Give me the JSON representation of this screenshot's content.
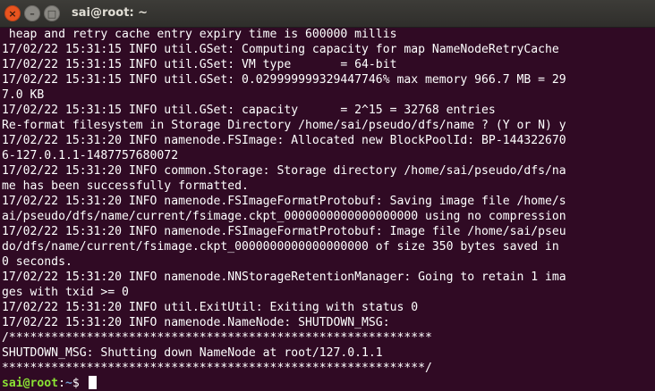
{
  "window": {
    "title": "sai@root: ~",
    "close_label": "×",
    "minimize_label": "–",
    "maximize_label": "□"
  },
  "terminal": {
    "lines": [
      " heap and retry cache entry expiry time is 600000 millis",
      "17/02/22 15:31:15 INFO util.GSet: Computing capacity for map NameNodeRetryCache",
      "17/02/22 15:31:15 INFO util.GSet: VM type       = 64-bit",
      "17/02/22 15:31:15 INFO util.GSet: 0.029999999329447746% max memory 966.7 MB = 29",
      "7.0 KB",
      "17/02/22 15:31:15 INFO util.GSet: capacity      = 2^15 = 32768 entries",
      "Re-format filesystem in Storage Directory /home/sai/pseudo/dfs/name ? (Y or N) y",
      "17/02/22 15:31:20 INFO namenode.FSImage: Allocated new BlockPoolId: BP-144322670",
      "6-127.0.1.1-1487757680072",
      "17/02/22 15:31:20 INFO common.Storage: Storage directory /home/sai/pseudo/dfs/na",
      "me has been successfully formatted.",
      "17/02/22 15:31:20 INFO namenode.FSImageFormatProtobuf: Saving image file /home/s",
      "ai/pseudo/dfs/name/current/fsimage.ckpt_0000000000000000000 using no compression",
      "17/02/22 15:31:20 INFO namenode.FSImageFormatProtobuf: Image file /home/sai/pseu",
      "do/dfs/name/current/fsimage.ckpt_0000000000000000000 of size 350 bytes saved in",
      "0 seconds.",
      "17/02/22 15:31:20 INFO namenode.NNStorageRetentionManager: Going to retain 1 ima",
      "ges with txid >= 0",
      "17/02/22 15:31:20 INFO util.ExitUtil: Exiting with status 0",
      "17/02/22 15:31:20 INFO namenode.NameNode: SHUTDOWN_MSG:",
      "/************************************************************",
      "SHUTDOWN_MSG: Shutting down NameNode at root/127.0.1.1",
      "************************************************************/"
    ],
    "prompt": {
      "user_host": "sai@root",
      "separator": ":",
      "path": "~",
      "symbol": "$ "
    }
  }
}
